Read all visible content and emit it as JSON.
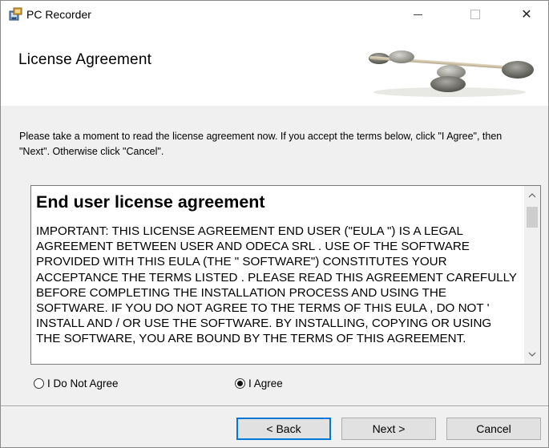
{
  "window": {
    "title": "PC Recorder",
    "minimize_icon": "minimize-icon",
    "maximize_icon": "maximize-icon",
    "close_icon": "close-icon",
    "close_glyph": "✕"
  },
  "banner": {
    "title": "License Agreement",
    "art": "balanced-stones-image"
  },
  "intro": "Please take a moment to read the license agreement now. If you accept the terms below, click \"I Agree\", then \"Next\". Otherwise click \"Cancel\".",
  "license": {
    "heading": "End user license agreement",
    "body": "IMPORTANT: THIS LICENSE AGREEMENT END USER (\"EULA \") IS A LEGAL AGREEMENT BETWEEN USER AND ODECA SRL . USE OF THE SOFTWARE PROVIDED WITH THIS EULA (THE \" SOFTWARE\") CONSTITUTES YOUR ACCEPTANCE THE TERMS LISTED . PLEASE READ THIS AGREEMENT CAREFULLY BEFORE COMPLETING THE INSTALLATION PROCESS AND USING THE SOFTWARE. IF YOU DO NOT AGREE TO THE TERMS OF THIS EULA , DO NOT ' INSTALL AND / OR USE THE SOFTWARE. BY INSTALLING, COPYING OR USING THE SOFTWARE, YOU ARE BOUND BY THE TERMS OF THIS AGREEMENT."
  },
  "options": {
    "disagree_label": "I Do Not Agree",
    "agree_label": "I Agree",
    "selected": "agree"
  },
  "buttons": {
    "back": "< Back",
    "next": "Next >",
    "cancel": "Cancel"
  },
  "colors": {
    "focus_accent": "#0078d7",
    "dialog_bg": "#f0f0f0"
  }
}
